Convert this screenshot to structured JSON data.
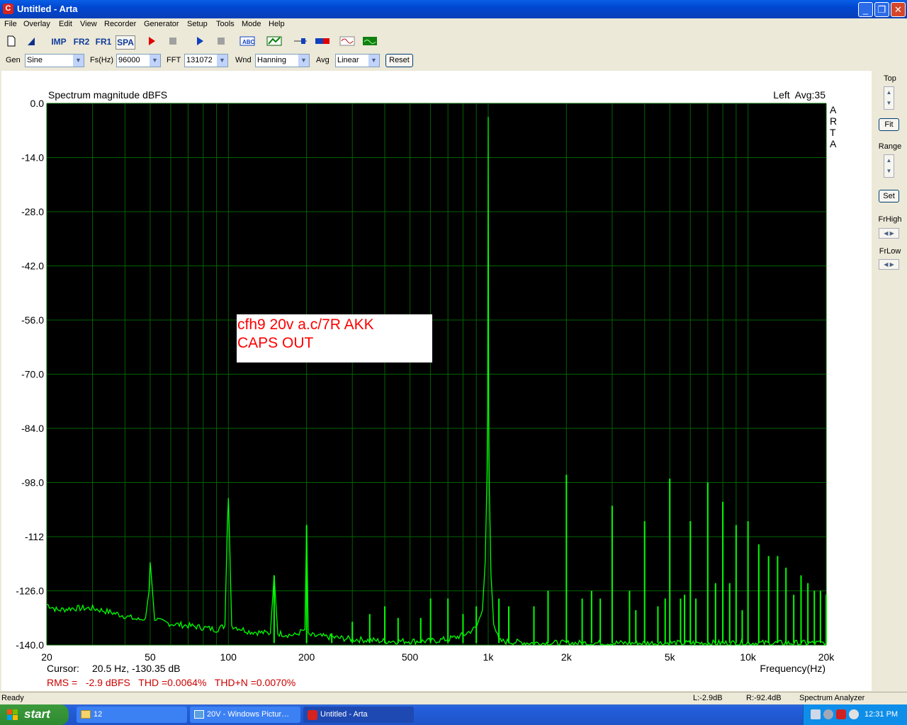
{
  "window": {
    "title": "Untitled - Arta",
    "app_icon": "C",
    "minimize_icon": "_",
    "restore_icon": "❐",
    "close_icon": "✕"
  },
  "menu": [
    "File",
    "Overlay",
    "Edit",
    "View",
    "Recorder",
    "Generator",
    "Setup",
    "Tools",
    "Mode",
    "Help"
  ],
  "toolbar": {
    "imp": "IMP",
    "fr2": "FR2",
    "fr1": "FR1",
    "spa": "SPA"
  },
  "controls": {
    "gen_label": "Gen",
    "gen_value": "Sine",
    "fs_label": "Fs(Hz)",
    "fs_value": "96000",
    "fft_label": "FFT",
    "fft_value": "131072",
    "wnd_label": "Wnd",
    "wnd_value": "Hanning",
    "avg_label": "Avg",
    "avg_value": "Linear",
    "reset_label": "Reset"
  },
  "right_panel": {
    "top_label": "Top",
    "fit_label": "Fit",
    "range_label": "Range",
    "set_label": "Set",
    "frhigh_label": "FrHigh",
    "frlow_label": "FrLow"
  },
  "plot": {
    "channel_info": "Left  Avg:35",
    "arta_vertical": [
      "A",
      "R",
      "T",
      "A"
    ],
    "annotation_line1": "cfh9 20v a.c/7R AKK",
    "annotation_line2": "CAPS OUT",
    "cursor_label": "Cursor:",
    "cursor_value": "20.5 Hz, -130.35 dB",
    "rms_text": "RMS =   -2.9 dBFS   THD =0.0064%   THD+N =0.0070%",
    "colors": {
      "background": "#000000",
      "grid": "#006400",
      "trace": "#00ff00",
      "annotation": "#ff0000",
      "measure": "#cc0000"
    }
  },
  "chart_data": {
    "type": "line",
    "title": "Spectrum magnitude dBFS",
    "xlabel": "Frequency(Hz)",
    "ylabel": "",
    "x_scale": "log",
    "xlim": [
      20,
      20000
    ],
    "ylim": [
      -140,
      0
    ],
    "grid": true,
    "ytick_labels": [
      "0.0",
      "-14.0",
      "-28.0",
      "-42.0",
      "-56.0",
      "-70.0",
      "-84.0",
      "-98.0",
      "-112",
      "-126.0",
      "-140.0"
    ],
    "xtick_labels": [
      {
        "f": 20,
        "label": "20"
      },
      {
        "f": 50,
        "label": "50"
      },
      {
        "f": 100,
        "label": "100"
      },
      {
        "f": 200,
        "label": "200"
      },
      {
        "f": 500,
        "label": "500"
      },
      {
        "f": 1000,
        "label": "1k"
      },
      {
        "f": 2000,
        "label": "2k"
      },
      {
        "f": 5000,
        "label": "5k"
      },
      {
        "f": 10000,
        "label": "10k"
      },
      {
        "f": 20000,
        "label": "20k"
      }
    ],
    "series": [
      {
        "points": [
          [
            20,
            -129.5
          ],
          [
            22,
            -131
          ],
          [
            25,
            -130.5
          ],
          [
            30,
            -130.5
          ],
          [
            35,
            -131.5
          ],
          [
            40,
            -132.5
          ],
          [
            45,
            -133.5
          ],
          [
            48,
            -133
          ],
          [
            49.5,
            -126
          ],
          [
            50,
            -119
          ],
          [
            50.5,
            -122
          ],
          [
            52,
            -133
          ],
          [
            55,
            -134
          ],
          [
            60,
            -134.5
          ],
          [
            70,
            -135
          ],
          [
            80,
            -135.5
          ],
          [
            90,
            -136
          ],
          [
            97,
            -135
          ],
          [
            99,
            -110
          ],
          [
            100,
            -102
          ],
          [
            101,
            -112
          ],
          [
            103,
            -135
          ],
          [
            120,
            -136.5
          ],
          [
            145,
            -137
          ],
          [
            150,
            -122
          ],
          [
            155,
            -137
          ],
          [
            180,
            -137.5
          ],
          [
            197,
            -136
          ],
          [
            200,
            -109
          ],
          [
            203,
            -137.5
          ],
          [
            250,
            -138
          ],
          [
            300,
            -138.5
          ],
          [
            400,
            -139
          ],
          [
            500,
            -139
          ],
          [
            600,
            -139
          ],
          [
            700,
            -138.5
          ],
          [
            800,
            -137.5
          ],
          [
            900,
            -135.5
          ],
          [
            950,
            -131
          ],
          [
            975,
            -118
          ],
          [
            990,
            -95
          ],
          [
            995,
            -78
          ],
          [
            1000,
            -3.5
          ],
          [
            1003,
            -52
          ],
          [
            1005,
            -80
          ],
          [
            1010,
            -99
          ],
          [
            1025,
            -122
          ],
          [
            1050,
            -134
          ],
          [
            1100,
            -139
          ],
          [
            1500,
            -139.5
          ],
          [
            3000,
            -139.5
          ],
          [
            6000,
            -139.5
          ],
          [
            12000,
            -139.5
          ],
          [
            20000,
            -139.5
          ]
        ]
      }
    ],
    "spikes": [
      [
        150,
        -122
      ],
      [
        200,
        -109
      ],
      [
        250,
        -137
      ],
      [
        300,
        -134
      ],
      [
        350,
        -132
      ],
      [
        400,
        -130
      ],
      [
        450,
        -133
      ],
      [
        550,
        -133
      ],
      [
        600,
        -128
      ],
      [
        700,
        -128
      ],
      [
        800,
        -132
      ],
      [
        900,
        -130
      ],
      [
        1100,
        -128
      ],
      [
        1200,
        -130
      ],
      [
        1500,
        -130
      ],
      [
        1700,
        -126
      ],
      [
        2000,
        -96
      ],
      [
        2300,
        -128
      ],
      [
        2500,
        -126
      ],
      [
        2700,
        -128
      ],
      [
        3000,
        -104
      ],
      [
        3500,
        -126
      ],
      [
        3700,
        -131
      ],
      [
        4000,
        -108
      ],
      [
        4500,
        -130
      ],
      [
        4800,
        -128
      ],
      [
        5000,
        -97
      ],
      [
        5500,
        -128
      ],
      [
        5700,
        -127
      ],
      [
        6000,
        -108
      ],
      [
        6300,
        -128
      ],
      [
        7000,
        -98
      ],
      [
        7500,
        -124
      ],
      [
        8000,
        -103
      ],
      [
        8500,
        -124
      ],
      [
        9000,
        -109
      ],
      [
        9500,
        -131
      ],
      [
        10000,
        -108
      ],
      [
        11000,
        -114
      ],
      [
        12000,
        -117
      ],
      [
        13000,
        -117
      ],
      [
        14000,
        -120
      ],
      [
        15000,
        -127
      ],
      [
        16000,
        -122
      ],
      [
        17000,
        -124
      ],
      [
        18000,
        -126
      ],
      [
        19000,
        -126
      ],
      [
        20000,
        -127
      ]
    ]
  },
  "status": {
    "left": "Ready",
    "l_level": "L:-2.9dB",
    "r_level": "R:-92.4dB",
    "mode": "Spectrum Analyzer"
  },
  "taskbar": {
    "start_label": "start",
    "tasks": [
      "12",
      "20V - Windows Pictur…",
      "Untitled - Arta"
    ],
    "clock": "12:31 PM"
  }
}
